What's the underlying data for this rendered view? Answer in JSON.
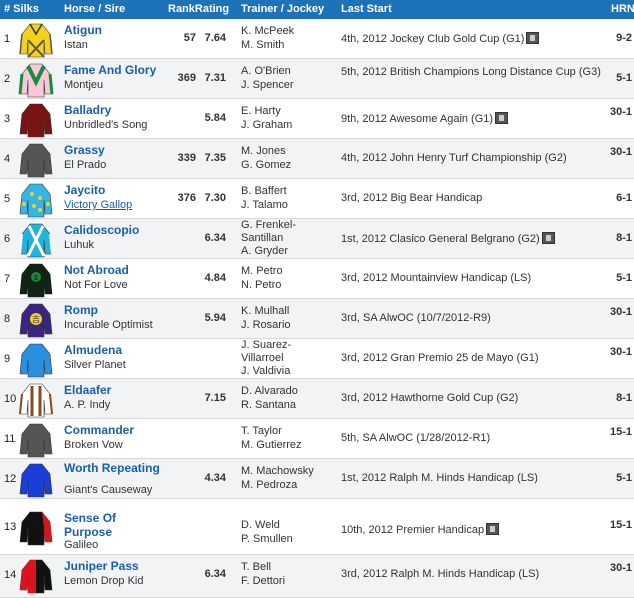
{
  "header": {
    "silks": "# Silks",
    "horse_sire": "Horse / Sire",
    "rank_rating": "RankRating",
    "trainer_jockey": "Trainer / Jockey",
    "last_start": "Last Start",
    "hrn": "HRN"
  },
  "rows": [
    {
      "num": "1",
      "horse": "Atigun",
      "sire": "Istan",
      "rank": "57",
      "rating": "7.64",
      "trainer": "K. McPeek",
      "jockey": "M. Smith",
      "last": "4th, 2012 Jockey Club Gold Cup (G1)",
      "hrn": "9-2"
    },
    {
      "num": "2",
      "horse": "Fame And Glory",
      "sire": "Montjeu",
      "rank": "369",
      "rating": "7.31",
      "trainer": "A. O'Brien",
      "jockey": "J. Spencer",
      "last": "5th, 2012 British Champions Long Distance Cup (G3)",
      "hrn": "5-1"
    },
    {
      "num": "3",
      "horse": "Balladry",
      "sire": "Unbridled's Song",
      "rank": "",
      "rating": "5.84",
      "trainer": "E. Harty",
      "jockey": "J. Graham",
      "last": "9th, 2012 Awesome Again (G1)",
      "hrn": "30-1"
    },
    {
      "num": "4",
      "horse": "Grassy",
      "sire": "El Prado",
      "rank": "339",
      "rating": "7.35",
      "trainer": "M. Jones",
      "jockey": "G. Gomez",
      "last": "4th, 2012 John Henry Turf Championship (G2)",
      "hrn": "30-1"
    },
    {
      "num": "5",
      "horse": "Jaycito",
      "sire": "Victory Gallop",
      "rank": "376",
      "rating": "7.30",
      "trainer": "B. Baffert",
      "jockey": "J. Talamo",
      "last": "3rd, 2012 Big Bear Handicap",
      "hrn": "6-1"
    },
    {
      "num": "6",
      "horse": "Calidoscopio",
      "sire": "Luhuk",
      "rank": "",
      "rating": "6.34",
      "trainer": "G. Frenkel-Santillan",
      "jockey": "A. Gryder",
      "last": "1st, 2012 Clasico General Belgrano (G2)",
      "hrn": "8-1"
    },
    {
      "num": "7",
      "horse": "Not Abroad",
      "sire": "Not For Love",
      "rank": "",
      "rating": "4.84",
      "trainer": "M. Petro",
      "jockey": "N. Petro",
      "last": "3rd, 2012 Mountainview Handicap (LS)",
      "hrn": "5-1"
    },
    {
      "num": "8",
      "horse": "Romp",
      "sire": "Incurable Optimist",
      "rank": "",
      "rating": "5.94",
      "trainer": "K. Mulhall",
      "jockey": "J. Rosario",
      "last": "3rd, SA AlwOC (10/7/2012-R9)",
      "hrn": "30-1"
    },
    {
      "num": "9",
      "horse": "Almudena",
      "sire": "Silver Planet",
      "rank": "",
      "rating": "",
      "trainer": "J. Suarez-Villarroel",
      "jockey": "J. Valdivia",
      "last": "3rd, 2012 Gran Premio 25 de Mayo (G1)",
      "hrn": "30-1"
    },
    {
      "num": "10",
      "horse": "Eldaafer",
      "sire": "A. P. Indy",
      "rank": "",
      "rating": "7.15",
      "trainer": "D. Alvarado",
      "jockey": "R. Santana",
      "last": "3rd, 2012 Hawthorne Gold Cup (G2)",
      "hrn": "8-1"
    },
    {
      "num": "11",
      "horse": "Commander",
      "sire": "Broken Vow",
      "rank": "",
      "rating": "",
      "trainer": "T. Taylor",
      "jockey": "M. Gutierrez",
      "last": "5th, SA AlwOC (1/28/2012-R1)",
      "hrn": "15-1"
    },
    {
      "num": "12",
      "horse": "Worth Repeating",
      "sire": "Giant's Causeway",
      "rank": "",
      "rating": "4.34",
      "trainer": "M. Machowsky",
      "jockey": "M. Pedroza",
      "last": "1st, 2012 Ralph M. Hinds Handicap (LS)",
      "hrn": "5-1"
    },
    {
      "num": "13",
      "horse": "Sense Of Purpose",
      "sire": "Galileo",
      "rank": "",
      "rating": "",
      "trainer": "D. Weld",
      "jockey": "P. Smullen",
      "last": "10th, 2012 Premier Handicap",
      "hrn": "15-1"
    },
    {
      "num": "14",
      "horse": "Juniper Pass",
      "sire": "Lemon Drop Kid",
      "rank": "",
      "rating": "6.34",
      "trainer": "T. Bell",
      "jockey": "F. Dettori",
      "last": "3rd, 2012 Ralph M. Hinds Handicap (LS)",
      "hrn": "30-1"
    }
  ],
  "colors": {
    "header_bg": "#1e73b8",
    "link": "#1a5fa8"
  }
}
